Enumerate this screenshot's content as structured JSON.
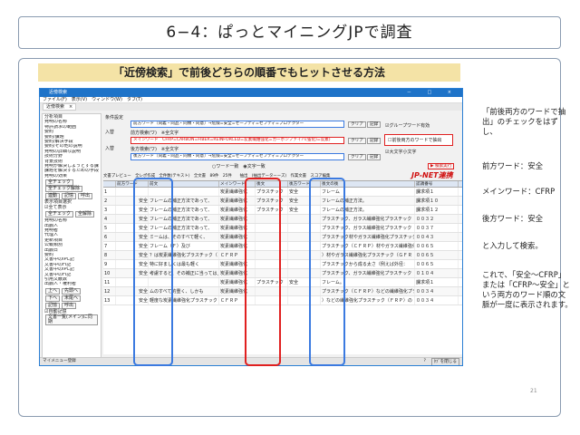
{
  "slide": {
    "title": "6−4：ぱっとマイニングJPで調査",
    "banner": "「近傍検索」で前後どちらの順番でもヒットさせる方法",
    "page_number": "21",
    "side_notes": [
      "「前後両方のワードで抽出」のチェックをはずし、",
      "前方ワード：安全",
      "メインワード：CFRP",
      "後方ワード：安全",
      "と入力して検索。",
      "これで、「安全～CFRP」または「CFRP～安全」という両方のワード順の文脈が一度に表示されます。"
    ]
  },
  "app": {
    "window_title": "近傍検索",
    "menu": "ファイル(F)　表示(V)　ウィンドウ(W)　タブ(T)",
    "tab": "近傍検索　×",
    "window_controls": "－ □ ×",
    "left_panel": {
      "section1": "分析項目",
      "items": [
        "発明の名称",
        "特許請求の範囲",
        "要約",
        "要約/課題",
        "要約/解決手段",
        "要約/その他の説明",
        "発明の詳細な説明",
        "技術分野",
        "背景技術",
        "発明が解決しようとする課題",
        "課題を解決するための手段",
        "発明の効果"
      ],
      "buttons1": [
        "全チェック",
        "全チェック解除"
      ],
      "buttons_mid": [
        "連動",
        "記憶",
        "呼出"
      ],
      "section2": "表示項目選択",
      "select_all": "全て表示",
      "buttons2": [
        "全チェック",
        "全解除"
      ],
      "items2": [
        "発明の名称",
        "出願人",
        "発明者",
        "代理人",
        "更新項目",
        "公報類別",
        "出願日",
        "要約",
        "文書中のIPC記",
        "文書中のFI記",
        "文書中のIPC記",
        "文書中のFI記",
        "引用文献数",
        "出願人・権利者"
      ],
      "nav": [
        "上へ",
        "先頭へ",
        "下へ",
        "末尾へ",
        "記憶",
        "呼出"
      ],
      "auto_register": "自動記憶",
      "doc_list": "文書一覧(メイン)に同期",
      "bottom": "マイメニュー登録"
    },
    "conditions": {
      "label": "条件設定",
      "front_label": "前方ワード",
      "front_value": "前方ワード（同義・同品・同類・同意）→危険=安全=セーフティ=セフティ=プロテクター",
      "in1": "入替",
      "front_check": "前方検索(ワ)　※全文字",
      "main_value": "メインワード　CFRP=CARBON=FIBER=REINFORCED=炭素繊維強化=カーボンファイバ(強化)=炭素)",
      "in2": "入替",
      "back_check": "後方検索(ワ)　※全文字",
      "back_value": "後方ワード（同義・同品・同類・同意）→危険=安全=セーフティ=セフティ=プロテクター",
      "clear": "クリア",
      "register": "記録",
      "group_word": "グループワード有効",
      "both_words": "前後両方のワードで抽出",
      "case": "大文字小文字",
      "exact": "○ワード一致　◉文字一致",
      "run": "▶ 検索実行"
    },
    "grid_toolbar": "文書プレビュー　全レポ作成　全件数(テキスト)　全文書　89件　25件　　抽出　(抽出データーーズ)　作業文書　スコア編集",
    "brand": "JP-NET連携",
    "columns": [
      "",
      "前方ワード",
      "前文",
      "メインワード",
      "後文",
      "後方ワード",
      "後文の後",
      "認識番号"
    ],
    "rows": [
      [
        "1",
        "",
        "",
        "炭素繊維強化",
        "プラスチック",
        "安全",
        "フレーム",
        "課求項１"
      ],
      [
        "2",
        "安全",
        "フレームの補正方法であって、",
        "炭素繊維強化",
        "プラスチック",
        "安全",
        "フレームの補正方法。",
        "課求項１０"
      ],
      [
        "3",
        "安全",
        "フレームの補正方法であって、",
        "炭素繊維強化",
        "プラスチック",
        "安全",
        "フレームの補正方法。",
        "課求項１２"
      ],
      [
        "4",
        "安全",
        "フレームの補正方法であって、",
        "炭素繊維強化",
        "",
        "",
        "プラスチック、ガラス繊維強化プラスチック",
        "００３２"
      ],
      [
        "5",
        "安全",
        "フレームの補正方法であって、",
        "炭素繊維強化",
        "",
        "",
        "プラスチック、ガラス繊維強化プラスチック",
        "００３７"
      ],
      [
        "6",
        "安全",
        "ミームは、そのすべて軽く、",
        "炭素繊維強化",
        "",
        "",
        "プラスチック材やガラス繊維強化プラスチック",
        "００４３"
      ],
      [
        "7",
        "安全",
        "フレーム（Ｆ）及び",
        "炭素繊維強化",
        "",
        "",
        "プラスチック（ＣＦＲＰ）材やガラス繊維強化",
        "００６５"
      ],
      [
        "8",
        "安全",
        "？は炭素繊維強化プラスチック（",
        "ＣＦＲＰ",
        "",
        "",
        "）材やガラス繊維強化プラスチック（ＧＦＲ",
        "００６５"
      ],
      [
        "9",
        "安全",
        "特に好ましくは最も軽く",
        "炭素繊維強化",
        "",
        "",
        "プラスチックから成る太さ（例えば外径：",
        "００６５"
      ],
      [
        "10",
        "安全",
        "考慮すると、その補正に当っては上",
        "炭素繊維強化",
        "",
        "",
        "プラスチック、ガラス繊維強化プラスチック",
        "０１０４"
      ],
      [
        "11",
        "",
        "",
        "炭素繊維強化",
        "プラスチック",
        "安全",
        "フレーム。",
        "課求項１"
      ],
      [
        "12",
        "安全",
        "ムのすべて的重く、しかも",
        "炭素繊維強化",
        "",
        "",
        "プラスチック（ＣＦＲＰ）などの繊維強化プラ",
        "００３４"
      ],
      [
        "13",
        "安全",
        "軽度な炭素繊維強化プラスチック（",
        "ＣＦＲＰ",
        "",
        "",
        "）などの繊維強化プラスチック（ＦＲＰ）の",
        "００３４"
      ]
    ],
    "status_left": "マイメニュー登録",
    "status_right": "ﾀﾌﾞを閉じる",
    "help": "?"
  },
  "colors": {
    "accent_red": "#e02020",
    "accent_blue": "#3b7ae0",
    "banner": "#f4e3a6",
    "titlebar": "#1e73c8"
  }
}
